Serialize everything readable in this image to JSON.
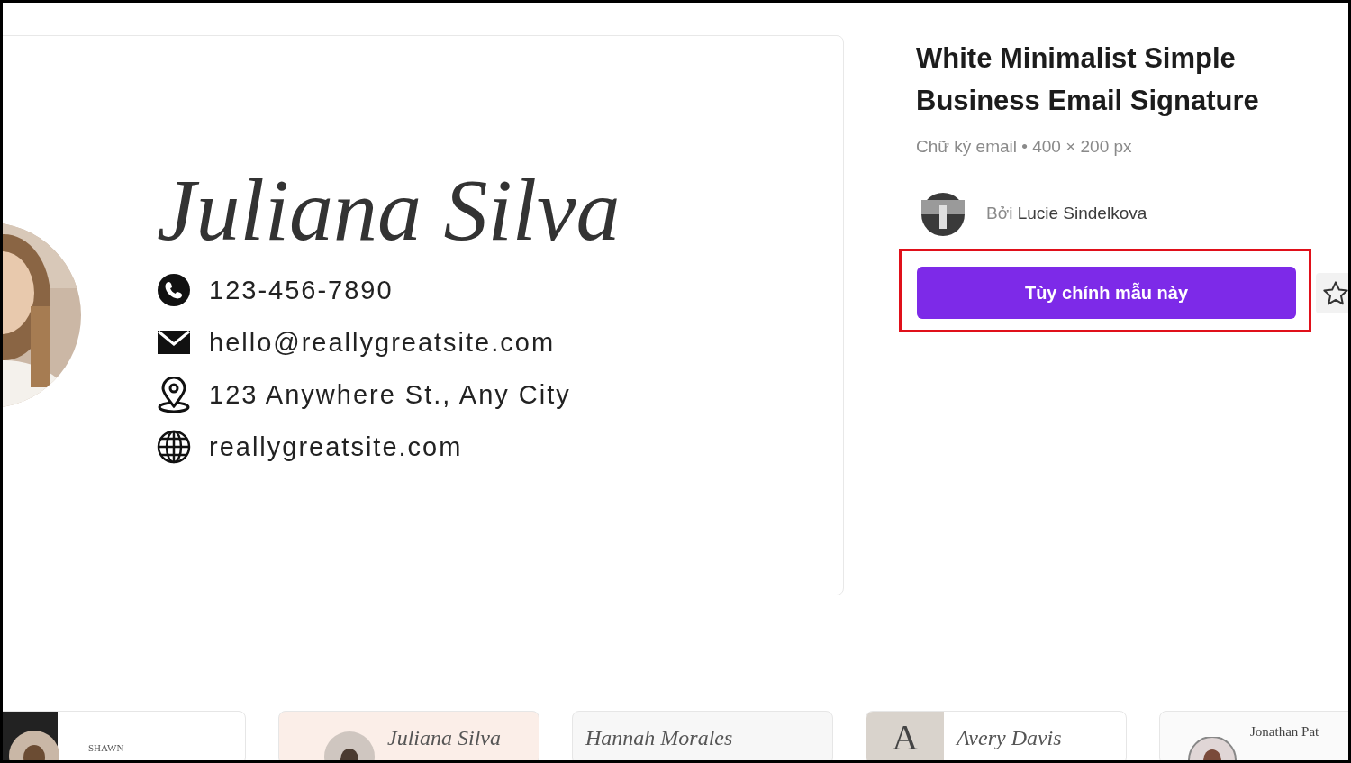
{
  "preview": {
    "name": "Juliana Silva",
    "contacts": [
      {
        "kind": "phone",
        "text": "123-456-7890"
      },
      {
        "kind": "email",
        "text": "hello@reallygreatsite.com"
      },
      {
        "kind": "address",
        "text": "123 Anywhere St., Any City"
      },
      {
        "kind": "web",
        "text": "reallygreatsite.com"
      }
    ]
  },
  "details": {
    "title": "White Minimalist Simple Business Email Signature",
    "meta": "Chữ ký email • 400 × 200 px",
    "by_label": "Bởi",
    "author": "Lucie Sindelkova",
    "button": "Tùy chỉnh mẫu này",
    "highlighted": true,
    "starred": false
  },
  "related": [
    {
      "kind": "photo-left",
      "texts": [
        "SHAWN"
      ]
    },
    {
      "kind": "script",
      "texts": [
        "Juliana Silva"
      ]
    },
    {
      "kind": "script-plain",
      "texts": [
        "Hannah Morales"
      ]
    },
    {
      "kind": "letter",
      "texts": [
        "A",
        "Avery Davis"
      ]
    },
    {
      "kind": "serif",
      "texts": [
        "Jonathan Pat"
      ]
    }
  ]
}
